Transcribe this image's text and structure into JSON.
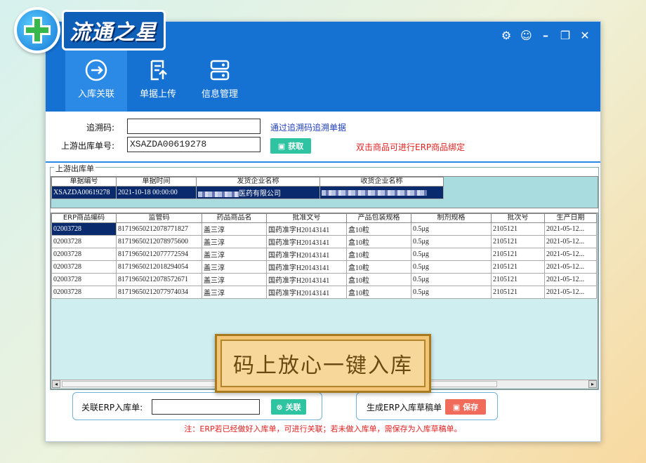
{
  "logo": {
    "text": "流通之星"
  },
  "window_controls": [
    "settings-gear",
    "lightbulb",
    "minimize",
    "restore",
    "close"
  ],
  "toolbar": [
    {
      "label": "入库关联",
      "icon": "link-in-icon",
      "active": true
    },
    {
      "label": "单据上传",
      "icon": "upload-doc-icon",
      "active": false
    },
    {
      "label": "信息管理",
      "icon": "info-manage-icon",
      "active": false
    }
  ],
  "form": {
    "trace_label": "追溯码:",
    "trace_value": "",
    "upstream_label": "上游出库单号:",
    "upstream_value": "XSAZDA00619278",
    "trace_link": "通过追溯码追溯单据",
    "fetch_button": "获取",
    "hint_red": "双击商品可进行ERP商品绑定"
  },
  "section_title": "上游出库单",
  "outbound_table": {
    "columns": [
      "单据编号",
      "单据时间",
      "发货企业名称",
      "收货企业名称"
    ],
    "rows": [
      [
        "XSAZDA00619278",
        "2021-10-18 00:00:00",
        "医药有限公司",
        ""
      ]
    ]
  },
  "product_table": {
    "columns": [
      "ERP商品编码",
      "监管码",
      "药品商品名",
      "批准文号",
      "产品包装规格",
      "制剂规格",
      "批次号",
      "生产日期"
    ],
    "rows": [
      [
        "02003728",
        "81719650212078771827",
        "盖三淳",
        "国药准字H20143141",
        "盒10粒",
        "0.5μg",
        "2105121",
        "2021-05-12..."
      ],
      [
        "02003728",
        "81719650212078975600",
        "盖三淳",
        "国药准字H20143141",
        "盒10粒",
        "0.5μg",
        "2105121",
        "2021-05-12..."
      ],
      [
        "02003728",
        "81719650212077772594",
        "盖三淳",
        "国药准字H20143141",
        "盒10粒",
        "0.5μg",
        "2105121",
        "2021-05-12..."
      ],
      [
        "02003728",
        "81719650212018294054",
        "盖三淳",
        "国药准字H20143141",
        "盒10粒",
        "0.5μg",
        "2105121",
        "2021-05-12..."
      ],
      [
        "02003728",
        "81719650212078572671",
        "盖三淳",
        "国药准字H20143141",
        "盒10粒",
        "0.5μg",
        "2105121",
        "2021-05-12..."
      ],
      [
        "02003728",
        "81719650212077974034",
        "盖三淳",
        "国药准字H20143141",
        "盒10粒",
        "0.5μg",
        "2105121",
        "2021-05-12..."
      ]
    ]
  },
  "overlay_text": "码上放心一键入库",
  "bottom": {
    "link_label": "关联ERP入库单:",
    "link_value": "",
    "link_button": "关联",
    "draft_label": "生成ERP入库草稿单",
    "save_button": "保存",
    "note": "注：ERP若已经做好入库单，可进行关联；若未做入库单，需保存为入库草稿单。"
  },
  "colors": {
    "titlebar": "#1572d3",
    "green": "#2ec3a1",
    "red": "#f06b5a",
    "grid_bg": "#cfeef0"
  }
}
